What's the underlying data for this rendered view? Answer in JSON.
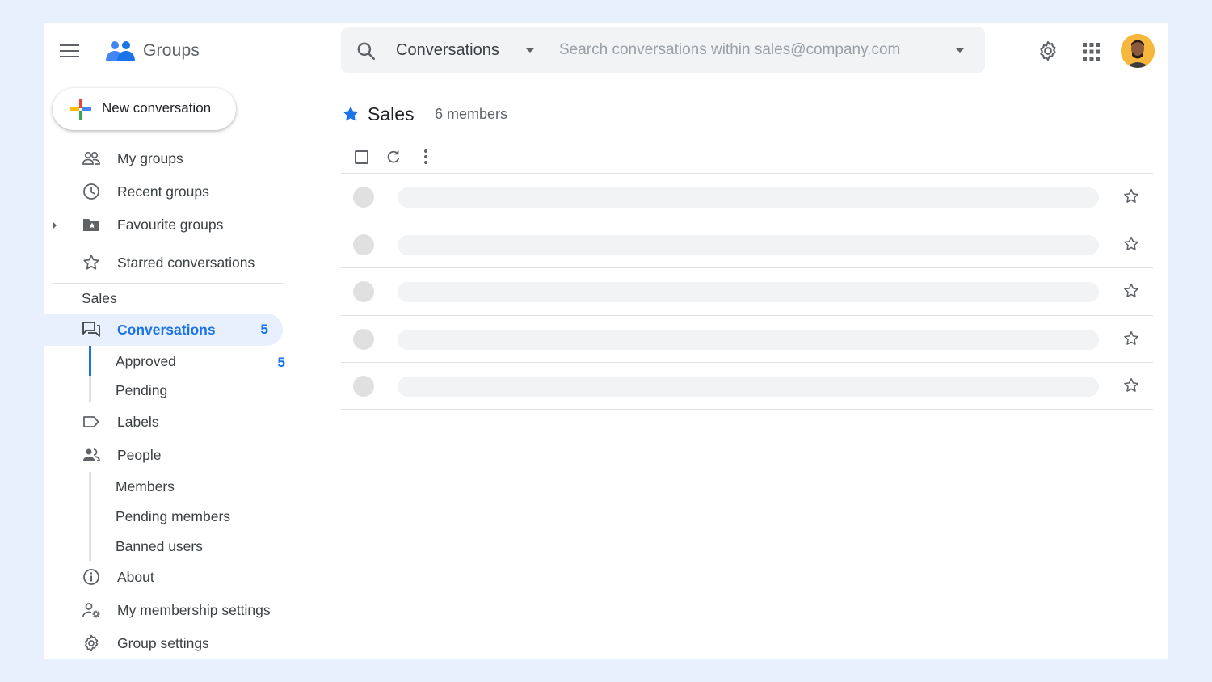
{
  "header": {
    "app_title": "Groups",
    "search_scope": "Conversations",
    "search_placeholder": "Search conversations within sales@company.com"
  },
  "sidebar": {
    "new_conversation": "New conversation",
    "items": [
      {
        "label": "My groups",
        "icon": "people-icon"
      },
      {
        "label": "Recent groups",
        "icon": "clock-icon"
      },
      {
        "label": "Favourite groups",
        "icon": "folder-star-icon"
      },
      {
        "label": "Starred conversations",
        "icon": "star-outline-icon"
      }
    ],
    "section_title": "Sales",
    "conversations": {
      "label": "Conversations",
      "count": "5"
    },
    "approved": {
      "label": "Approved",
      "count": "5"
    },
    "pending": {
      "label": "Pending"
    },
    "labels": {
      "label": "Labels"
    },
    "people": {
      "label": "People"
    },
    "people_sub": [
      "Members",
      "Pending members",
      "Banned users"
    ],
    "about": {
      "label": "About"
    },
    "membership": {
      "label": "My membership settings"
    },
    "group_settings": {
      "label": "Group settings"
    }
  },
  "main": {
    "group_name": "Sales",
    "members_count": "6 members",
    "rows": 5
  },
  "colors": {
    "accent": "#1a73e8",
    "page_background": "#e8f0fd"
  }
}
